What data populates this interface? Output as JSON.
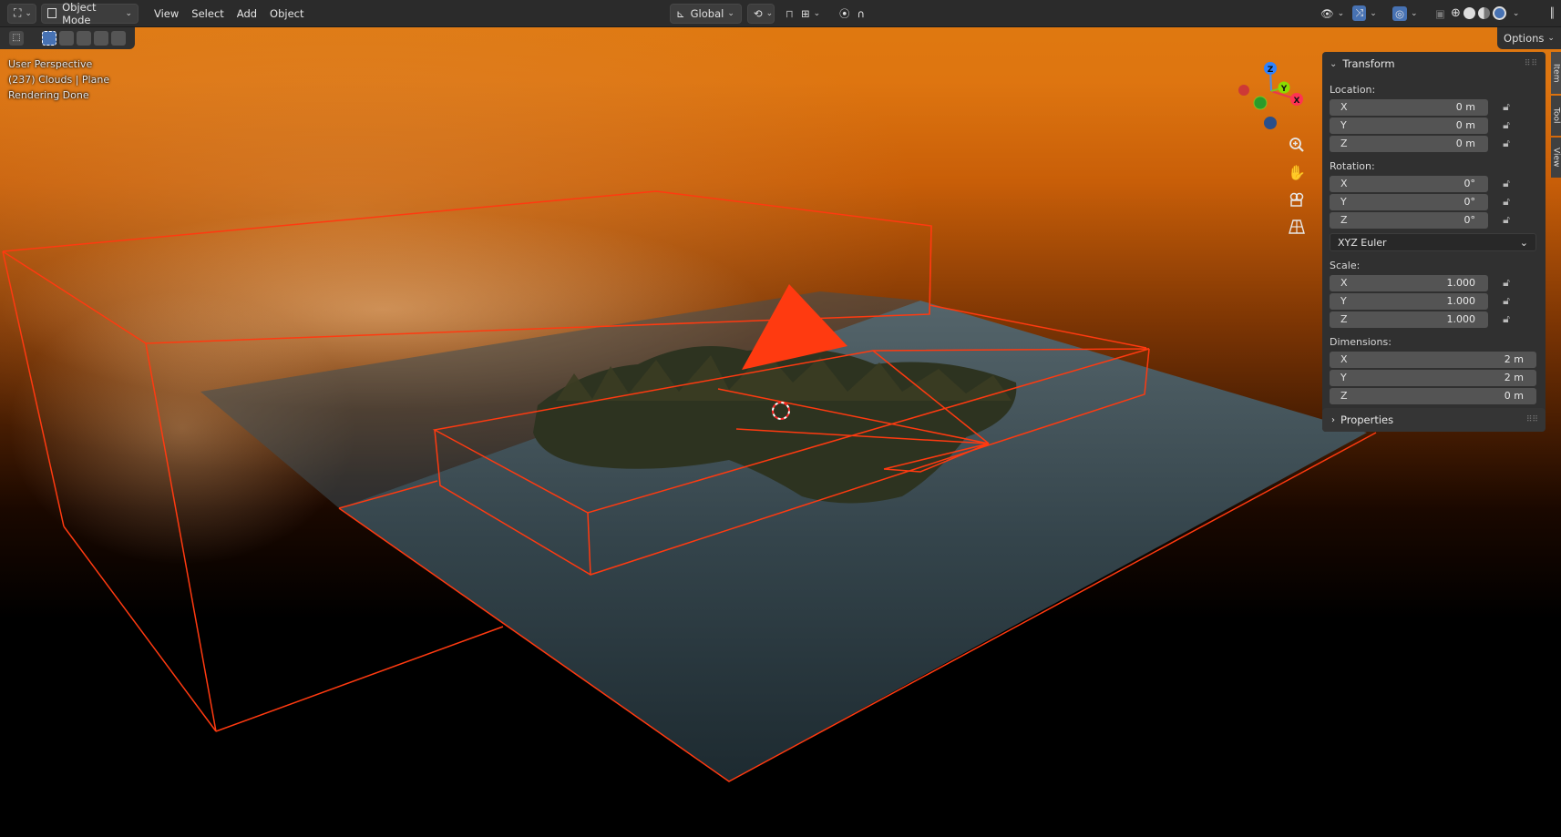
{
  "header": {
    "mode": "Object Mode",
    "menus": [
      "View",
      "Select",
      "Add",
      "Object"
    ],
    "transform_orientation": "Global"
  },
  "toolbar": {
    "options_label": "Options"
  },
  "overlay": {
    "view_name": "User Perspective",
    "object_info": "(237) Clouds | Plane",
    "render_status": "Rendering Done"
  },
  "gizmo": {
    "axes": [
      "X",
      "Y",
      "Z"
    ]
  },
  "npanel": {
    "transform_title": "Transform",
    "location_label": "Location:",
    "location": [
      {
        "axis": "X",
        "value": "0 m"
      },
      {
        "axis": "Y",
        "value": "0 m"
      },
      {
        "axis": "Z",
        "value": "0 m"
      }
    ],
    "rotation_label": "Rotation:",
    "rotation": [
      {
        "axis": "X",
        "value": "0°"
      },
      {
        "axis": "Y",
        "value": "0°"
      },
      {
        "axis": "Z",
        "value": "0°"
      }
    ],
    "rotation_mode": "XYZ Euler",
    "scale_label": "Scale:",
    "scale": [
      {
        "axis": "X",
        "value": "1.000"
      },
      {
        "axis": "Y",
        "value": "1.000"
      },
      {
        "axis": "Z",
        "value": "1.000"
      }
    ],
    "dimensions_label": "Dimensions:",
    "dimensions": [
      {
        "axis": "X",
        "value": "2 m"
      },
      {
        "axis": "Y",
        "value": "2 m"
      },
      {
        "axis": "Z",
        "value": "0 m"
      }
    ],
    "properties_title": "Properties"
  },
  "side_tabs": [
    "Item",
    "Tool",
    "View"
  ],
  "colors": {
    "selection_outline": "#ff3a10",
    "header_bg": "#2b2b2b",
    "panel_bg": "#303030",
    "field_bg": "#545454",
    "sky_orange": "#e07a10",
    "water": "#2e3d44"
  }
}
